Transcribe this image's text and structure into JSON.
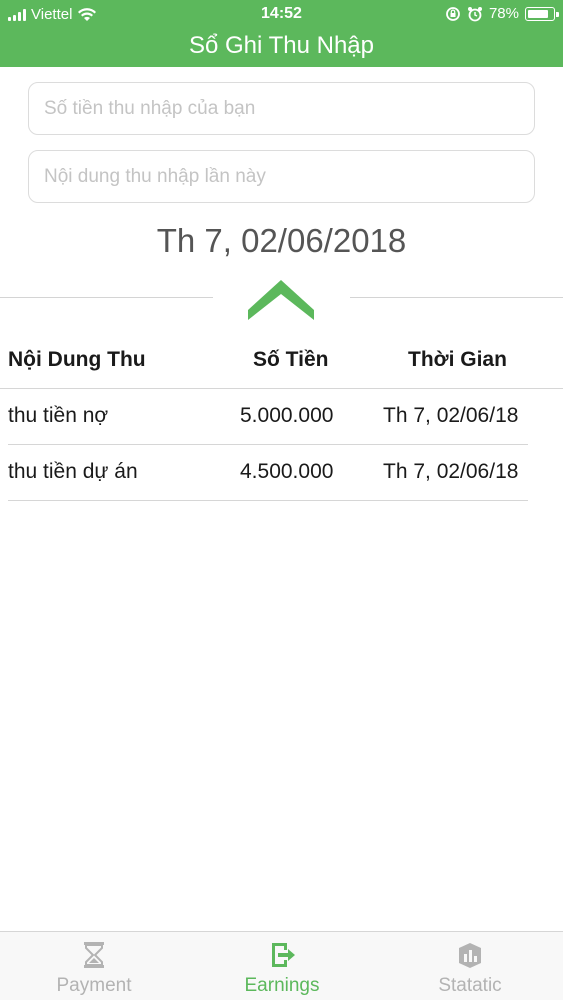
{
  "status_bar": {
    "carrier": "Viettel",
    "time": "14:52",
    "battery": "78%"
  },
  "nav": {
    "title": "Sổ Ghi Thu Nhập"
  },
  "form": {
    "amount_placeholder": "Số tiền thu nhập của bạn",
    "amount_value": "",
    "note_placeholder": "Nội dung thu nhập lần này",
    "note_value": ""
  },
  "selected_date": "Th 7, 02/06/2018",
  "table": {
    "headers": [
      "Nội Dung Thu",
      "Số Tiền",
      "Thời Gian"
    ],
    "rows": [
      {
        "content": "thu tiền nợ",
        "amount": "5.000.000",
        "time": "Th 7, 02/06/18"
      },
      {
        "content": "thu tiền dự án",
        "amount": "4.500.000",
        "time": "Th 7, 02/06/18"
      }
    ]
  },
  "tabs": [
    {
      "label": "Payment",
      "icon": "hourglass-icon",
      "active": false
    },
    {
      "label": "Earnings",
      "icon": "exit-door-icon",
      "active": true
    },
    {
      "label": "Statatic",
      "icon": "chart-box-icon",
      "active": false
    }
  ],
  "colors": {
    "primary": "#5cb85c",
    "inactive": "#b3b3b3"
  }
}
